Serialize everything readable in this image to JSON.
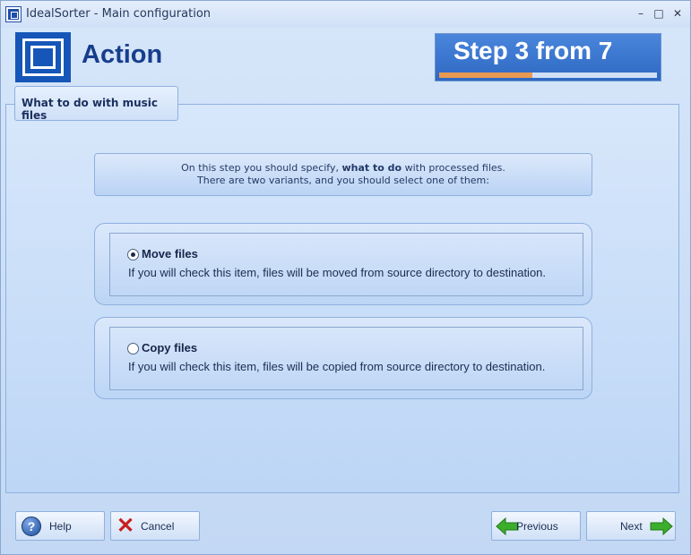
{
  "window": {
    "title": "IdealSorter - Main configuration",
    "min_glyph": "–",
    "max_glyph": "□",
    "close_glyph": "✕"
  },
  "header": {
    "title": "Action",
    "step_text": "Step 3 from 7",
    "step_current": 3,
    "step_total": 7,
    "progress_fraction": 0.43
  },
  "page_tab": {
    "label": "What to do with music files"
  },
  "info": {
    "line1_prefix": "On this step you should specify, ",
    "line1_bold": "what to do",
    "line1_suffix": " with processed files.",
    "line2": "There are two variants, and you should select one of them:"
  },
  "options": [
    {
      "title": "Move files",
      "description": "If you will check this item, files will be moved from source directory to destination.",
      "selected": true
    },
    {
      "title": "Copy files",
      "description": "If you will check this item, files will be copied from source directory to destination.",
      "selected": false
    }
  ],
  "buttons": {
    "help": "Help",
    "cancel": "Cancel",
    "previous": "Previous",
    "next": "Next"
  },
  "colors": {
    "accent": "#1556b8",
    "progress": "#e89a52",
    "arrow_green": "#3cae2c",
    "cancel_red": "#c81e1e"
  }
}
